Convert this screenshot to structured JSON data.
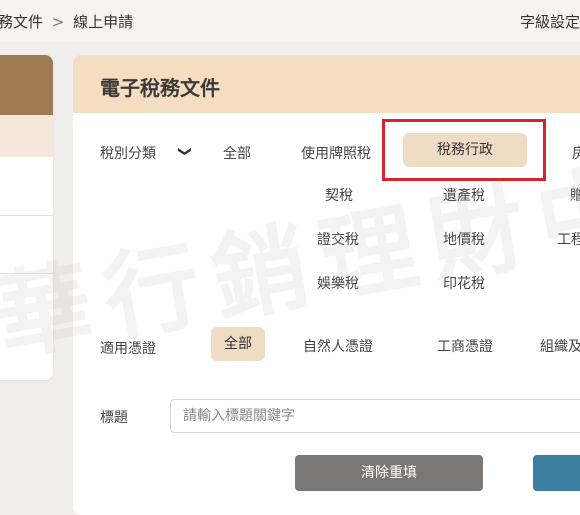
{
  "breadcrumb": {
    "prev": "務文件",
    "sep": ">",
    "current": "線上申請"
  },
  "font_size_label": "字級設定",
  "main": {
    "title": "電子稅務文件"
  },
  "tax_category": {
    "label": "稅別分類",
    "chevron": "❯",
    "options": [
      "全部",
      "使用牌照稅",
      "稅務行政",
      "房",
      "契稅",
      "遺產稅",
      "贈",
      "證交稅",
      "地價稅",
      "工程",
      "娛樂稅",
      "印花稅"
    ]
  },
  "certificate": {
    "label": "適用憑證",
    "options": [
      "全部",
      "自然人憑證",
      "工商憑證",
      "組織及"
    ]
  },
  "title_field": {
    "label": "標題",
    "placeholder": "請輸入標題關鍵字"
  },
  "buttons": {
    "clear": "清除重填"
  },
  "watermark": "華行銷理財中",
  "colors": {
    "accent": "#efdcc5",
    "header": "#f4ddc0",
    "highlight": "#d3262b",
    "primary": "#3b7ea0",
    "secondary": "#7a7774"
  }
}
